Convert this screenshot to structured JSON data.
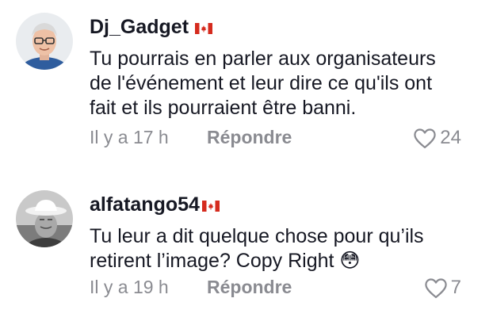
{
  "comments": [
    {
      "username": "Dj_Gadget",
      "flag_icon": "canada-flag-icon",
      "text_lines": [
        "Tu pourrais en parler aux organisateurs",
        "de l'événement et leur dire ce qu'ils ont",
        "fait et ils pourraient être banni."
      ],
      "timestamp": "Il y a 17 h",
      "reply_label": "Répondre",
      "like_count": "24"
    },
    {
      "username": "alfatango54",
      "flag_icon": "canada-flag-icon",
      "text_lines": [
        "Tu leur a dit quelque chose pour qu’ils",
        "retirent l’image? Copy Right 😳"
      ],
      "timestamp": "Il y a 19 h",
      "reply_label": "Répondre",
      "like_count": "7"
    }
  ],
  "colors": {
    "primary_text": "#161823",
    "secondary_text": "#8a8b91",
    "flag_red": "#d52b1e"
  }
}
